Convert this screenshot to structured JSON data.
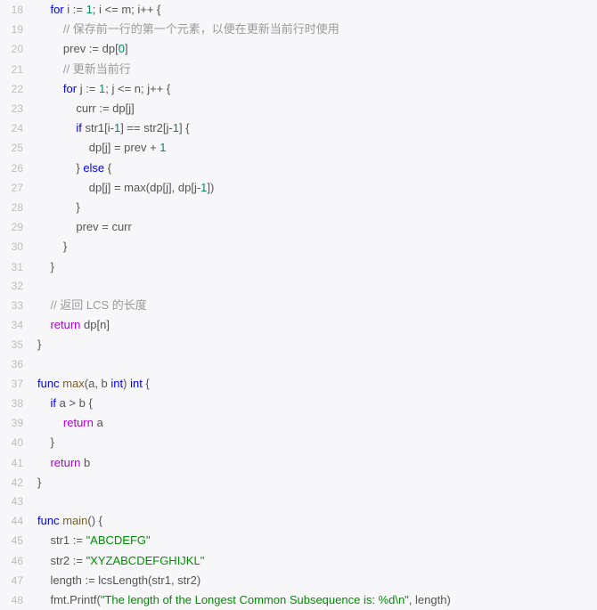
{
  "chart_data": null,
  "code": {
    "lines": [
      {
        "n": "18",
        "indent": "    ",
        "tokens": [
          {
            "cls": "tok-kw",
            "text": "for"
          },
          {
            "cls": "tok-op",
            "text": " i := "
          },
          {
            "cls": "tok-num",
            "text": "1"
          },
          {
            "cls": "tok-op",
            "text": "; i <= m; i++ {"
          }
        ]
      },
      {
        "n": "19",
        "indent": "        ",
        "tokens": [
          {
            "cls": "tok-cmt",
            "text": "// 保存前一行的第一个元素，以便在更新当前行时使用"
          }
        ]
      },
      {
        "n": "20",
        "indent": "        ",
        "tokens": [
          {
            "cls": "tok-op",
            "text": "prev := dp["
          },
          {
            "cls": "tok-num",
            "text": "0"
          },
          {
            "cls": "tok-op",
            "text": "]"
          }
        ]
      },
      {
        "n": "21",
        "indent": "        ",
        "tokens": [
          {
            "cls": "tok-cmt",
            "text": "// 更新当前行"
          }
        ]
      },
      {
        "n": "22",
        "indent": "        ",
        "tokens": [
          {
            "cls": "tok-kw",
            "text": "for"
          },
          {
            "cls": "tok-op",
            "text": " j := "
          },
          {
            "cls": "tok-num",
            "text": "1"
          },
          {
            "cls": "tok-op",
            "text": "; j <= n; j++ {"
          }
        ]
      },
      {
        "n": "23",
        "indent": "            ",
        "tokens": [
          {
            "cls": "tok-op",
            "text": "curr := dp[j]"
          }
        ]
      },
      {
        "n": "24",
        "indent": "            ",
        "tokens": [
          {
            "cls": "tok-kw",
            "text": "if"
          },
          {
            "cls": "tok-op",
            "text": " str1[i-"
          },
          {
            "cls": "tok-num",
            "text": "1"
          },
          {
            "cls": "tok-op",
            "text": "] == str2[j-"
          },
          {
            "cls": "tok-num",
            "text": "1"
          },
          {
            "cls": "tok-op",
            "text": "] {"
          }
        ]
      },
      {
        "n": "25",
        "indent": "                ",
        "tokens": [
          {
            "cls": "tok-op",
            "text": "dp[j] = prev + "
          },
          {
            "cls": "tok-num",
            "text": "1"
          }
        ]
      },
      {
        "n": "26",
        "indent": "            ",
        "tokens": [
          {
            "cls": "tok-op",
            "text": "} "
          },
          {
            "cls": "tok-kw",
            "text": "else"
          },
          {
            "cls": "tok-op",
            "text": " {"
          }
        ]
      },
      {
        "n": "27",
        "indent": "                ",
        "tokens": [
          {
            "cls": "tok-op",
            "text": "dp[j] = max(dp[j], dp[j-"
          },
          {
            "cls": "tok-num",
            "text": "1"
          },
          {
            "cls": "tok-op",
            "text": "])"
          }
        ]
      },
      {
        "n": "28",
        "indent": "            ",
        "tokens": [
          {
            "cls": "tok-op",
            "text": "}"
          }
        ]
      },
      {
        "n": "29",
        "indent": "            ",
        "tokens": [
          {
            "cls": "tok-op",
            "text": "prev = curr"
          }
        ]
      },
      {
        "n": "30",
        "indent": "        ",
        "tokens": [
          {
            "cls": "tok-op",
            "text": "}"
          }
        ]
      },
      {
        "n": "31",
        "indent": "    ",
        "tokens": [
          {
            "cls": "tok-op",
            "text": "}"
          }
        ]
      },
      {
        "n": "32",
        "indent": "",
        "tokens": []
      },
      {
        "n": "33",
        "indent": "    ",
        "tokens": [
          {
            "cls": "tok-cmt",
            "text": "// 返回 LCS 的长度"
          }
        ]
      },
      {
        "n": "34",
        "indent": "    ",
        "tokens": [
          {
            "cls": "tok-ret",
            "text": "return"
          },
          {
            "cls": "tok-op",
            "text": " dp[n]"
          }
        ]
      },
      {
        "n": "35",
        "indent": "",
        "tokens": [
          {
            "cls": "tok-op",
            "text": "}"
          }
        ]
      },
      {
        "n": "36",
        "indent": "",
        "tokens": []
      },
      {
        "n": "37",
        "indent": "",
        "tokens": [
          {
            "cls": "tok-kw",
            "text": "func"
          },
          {
            "cls": "tok-op",
            "text": " "
          },
          {
            "cls": "tok-fn",
            "text": "max"
          },
          {
            "cls": "tok-op",
            "text": "(a, b "
          },
          {
            "cls": "tok-kw",
            "text": "int"
          },
          {
            "cls": "tok-op",
            "text": ") "
          },
          {
            "cls": "tok-kw",
            "text": "int"
          },
          {
            "cls": "tok-op",
            "text": " {"
          }
        ]
      },
      {
        "n": "38",
        "indent": "    ",
        "tokens": [
          {
            "cls": "tok-kw",
            "text": "if"
          },
          {
            "cls": "tok-op",
            "text": " a > b {"
          }
        ]
      },
      {
        "n": "39",
        "indent": "        ",
        "tokens": [
          {
            "cls": "tok-ret",
            "text": "return"
          },
          {
            "cls": "tok-op",
            "text": " a"
          }
        ]
      },
      {
        "n": "40",
        "indent": "    ",
        "tokens": [
          {
            "cls": "tok-op",
            "text": "}"
          }
        ]
      },
      {
        "n": "41",
        "indent": "    ",
        "tokens": [
          {
            "cls": "tok-ret",
            "text": "return"
          },
          {
            "cls": "tok-op",
            "text": " b"
          }
        ]
      },
      {
        "n": "42",
        "indent": "",
        "tokens": [
          {
            "cls": "tok-op",
            "text": "}"
          }
        ]
      },
      {
        "n": "43",
        "indent": "",
        "tokens": []
      },
      {
        "n": "44",
        "indent": "",
        "tokens": [
          {
            "cls": "tok-kw",
            "text": "func"
          },
          {
            "cls": "tok-op",
            "text": " "
          },
          {
            "cls": "tok-fn",
            "text": "main"
          },
          {
            "cls": "tok-op",
            "text": "() {"
          }
        ]
      },
      {
        "n": "45",
        "indent": "    ",
        "tokens": [
          {
            "cls": "tok-op",
            "text": "str1 := "
          },
          {
            "cls": "tok-str",
            "text": "\"ABCDEFG\""
          }
        ]
      },
      {
        "n": "46",
        "indent": "    ",
        "tokens": [
          {
            "cls": "tok-op",
            "text": "str2 := "
          },
          {
            "cls": "tok-str",
            "text": "\"XYZABCDEFGHIJKL\""
          }
        ]
      },
      {
        "n": "47",
        "indent": "    ",
        "tokens": [
          {
            "cls": "tok-op",
            "text": "length := lcsLength(str1, str2)"
          }
        ]
      },
      {
        "n": "48",
        "indent": "    ",
        "tokens": [
          {
            "cls": "tok-op",
            "text": "fmt.Printf("
          },
          {
            "cls": "tok-str",
            "text": "\"The length of the Longest Common Subsequence is: %d\\n\""
          },
          {
            "cls": "tok-op",
            "text": ", length)"
          }
        ]
      }
    ]
  }
}
